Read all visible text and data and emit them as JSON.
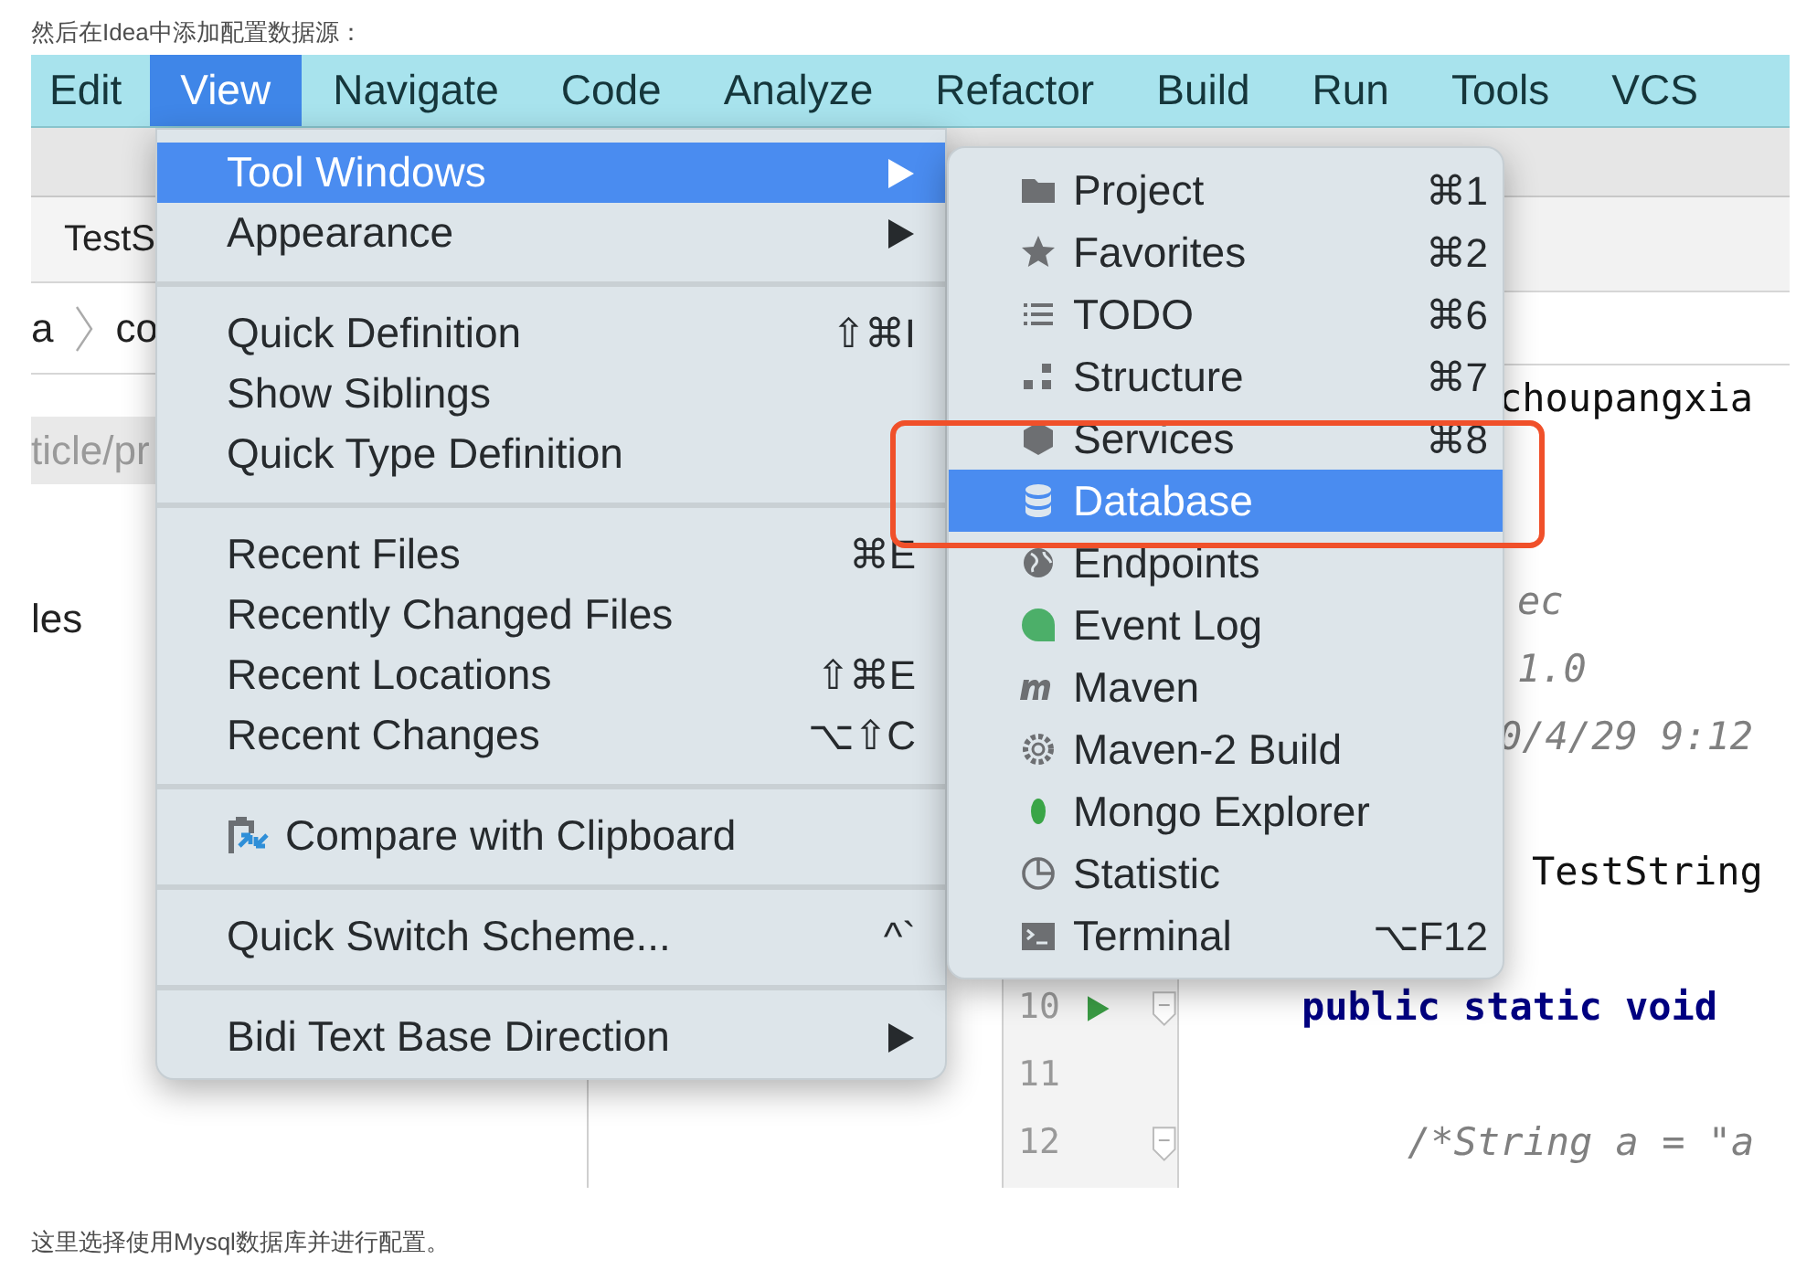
{
  "intro_text": "然后在Idea中添加配置数据源：",
  "screenshot": {
    "menu_bar": [
      {
        "label": "Edit",
        "selected": false
      },
      {
        "label": "View",
        "selected": true
      },
      {
        "label": "Navigate",
        "selected": false
      },
      {
        "label": "Code",
        "selected": false
      },
      {
        "label": "Analyze",
        "selected": false
      },
      {
        "label": "Refactor",
        "selected": false
      },
      {
        "label": "Build",
        "selected": false
      },
      {
        "label": "Run",
        "selected": false
      },
      {
        "label": "Tools",
        "selected": false
      },
      {
        "label": "VCS",
        "selected": false
      }
    ],
    "file_tab": "TestS",
    "breadcrumb": [
      "a",
      "co"
    ],
    "path_text": "ticle/pr",
    "side_text": "les",
    "editor_lines": [
      {
        "kind": "plain",
        "text": "choupangxia"
      },
      {
        "kind": "italic",
        "text": "ec"
      },
      {
        "kind": "italic",
        "text": "1.0"
      },
      {
        "kind": "italic",
        "text": "0/4/29 9:12"
      },
      {
        "kind": "plain",
        "text": "TestString"
      },
      {
        "kind": "keyword",
        "number": "10",
        "text": "public static void",
        "run": true,
        "fold": true
      },
      {
        "number": "11"
      },
      {
        "kind": "italic",
        "number": "12",
        "text": "/*String a = \"a",
        "fold": true
      }
    ],
    "view_menu": [
      {
        "kind": "item",
        "label": "Tool Windows",
        "submenu": true,
        "selected": true
      },
      {
        "kind": "item",
        "label": "Appearance",
        "submenu": true,
        "selected": false
      },
      {
        "kind": "separator"
      },
      {
        "kind": "item",
        "label": "Quick Definition",
        "shortcut": "⇧⌘I",
        "selected": false
      },
      {
        "kind": "item",
        "label": "Show Siblings",
        "selected": false
      },
      {
        "kind": "item",
        "label": "Quick Type Definition",
        "selected": false
      },
      {
        "kind": "separator"
      },
      {
        "kind": "item",
        "label": "Recent Files",
        "shortcut": "⌘E",
        "selected": false
      },
      {
        "kind": "item",
        "label": "Recently Changed Files",
        "selected": false
      },
      {
        "kind": "item",
        "label": "Recent Locations",
        "shortcut": "⇧⌘E",
        "selected": false
      },
      {
        "kind": "item",
        "label": "Recent Changes",
        "shortcut": "⌥⇧C",
        "selected": false
      },
      {
        "kind": "separator"
      },
      {
        "kind": "item",
        "label": "Compare with Clipboard",
        "icon": true,
        "selected": false
      },
      {
        "kind": "separator"
      },
      {
        "kind": "item",
        "label": "Quick Switch Scheme...",
        "shortcut": "^`",
        "selected": false
      },
      {
        "kind": "separator"
      },
      {
        "kind": "item",
        "label": "Bidi Text Base Direction",
        "submenu": true,
        "selected": false
      }
    ],
    "tool_windows_menu": [
      {
        "label": "Project",
        "shortcut": "⌘1",
        "selected": false
      },
      {
        "label": "Favorites",
        "shortcut": "⌘2",
        "selected": false
      },
      {
        "label": "TODO",
        "shortcut": "⌘6",
        "selected": false
      },
      {
        "label": "Structure",
        "shortcut": "⌘7",
        "selected": false
      },
      {
        "label": "Services",
        "shortcut": "⌘8",
        "selected": false
      },
      {
        "label": "Database",
        "selected": true
      },
      {
        "label": "Endpoints",
        "selected": false
      },
      {
        "label": "Event Log",
        "selected": false
      },
      {
        "label": "Maven",
        "selected": false
      },
      {
        "label": "Maven-2 Build",
        "selected": false
      },
      {
        "label": "Mongo Explorer",
        "selected": false
      },
      {
        "label": "Statistic",
        "selected": false
      },
      {
        "label": "Terminal",
        "shortcut": "⌥F12",
        "selected": false
      }
    ],
    "highlight_box": true
  },
  "outro_text": "这里选择使用Mysql数据库并进行配置。"
}
